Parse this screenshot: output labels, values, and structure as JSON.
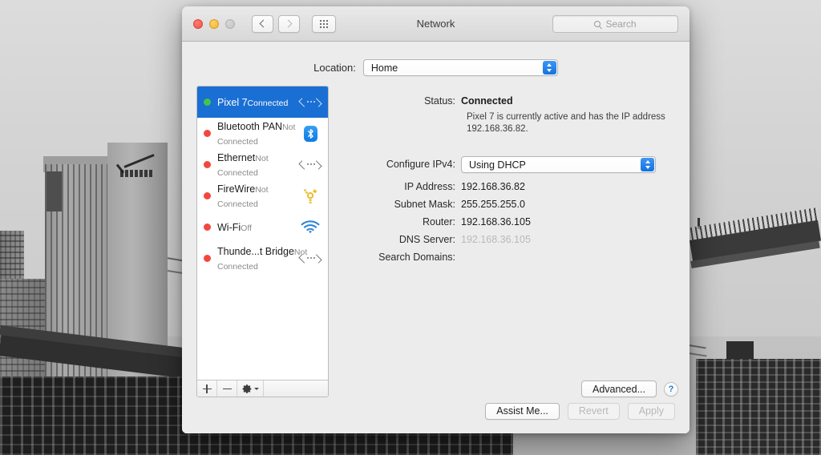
{
  "window": {
    "title": "Network",
    "traffic_lights": [
      "close",
      "minimize",
      "zoom-disabled"
    ],
    "search_placeholder": "Search",
    "back_icon": "chevron-left-icon",
    "forward_icon": "chevron-right-icon",
    "grid_icon": "show-all-grid-icon",
    "search_icon": "search-icon"
  },
  "location": {
    "label": "Location:",
    "value": "Home"
  },
  "services": [
    {
      "name": "Pixel 7",
      "status": "Connected",
      "dot": "green",
      "icon": "ethernet-chevron-icon",
      "selected": true
    },
    {
      "name": "Bluetooth PAN",
      "status": "Not Connected",
      "dot": "red",
      "icon": "bluetooth-icon",
      "selected": false
    },
    {
      "name": "Ethernet",
      "status": "Not Connected",
      "dot": "red",
      "icon": "ethernet-chevron-icon",
      "selected": false
    },
    {
      "name": "FireWire",
      "status": "Not Connected",
      "dot": "red",
      "icon": "firewire-icon",
      "selected": false
    },
    {
      "name": "Wi-Fi",
      "status": "Off",
      "dot": "red",
      "icon": "wifi-icon",
      "selected": false
    },
    {
      "name": "Thunde...t Bridge",
      "status": "Not Connected",
      "dot": "red",
      "icon": "ethernet-chevron-icon",
      "selected": false
    }
  ],
  "list_toolbar": {
    "add_label": "+",
    "remove_label": "−",
    "add_icon": "plus-icon",
    "remove_icon": "minus-icon",
    "gear_icon": "gear-icon",
    "gear_chevron_icon": "chevron-down-icon"
  },
  "detail": {
    "status_label": "Status:",
    "status_value": "Connected",
    "status_description": "Pixel 7 is currently active and has the IP address 192.168.36.82.",
    "configure_label": "Configure IPv4:",
    "configure_value": "Using DHCP",
    "rows": [
      {
        "label": "IP Address:",
        "value": "192.168.36.82",
        "dim": false
      },
      {
        "label": "Subnet Mask:",
        "value": "255.255.255.0",
        "dim": false
      },
      {
        "label": "Router:",
        "value": "192.168.36.105",
        "dim": false
      },
      {
        "label": "DNS Server:",
        "value": "192.168.36.105",
        "dim": true
      },
      {
        "label": "Search Domains:",
        "value": "",
        "dim": false
      }
    ]
  },
  "buttons": {
    "advanced": "Advanced...",
    "help": "?",
    "assist_me": "Assist Me...",
    "revert": "Revert",
    "apply": "Apply",
    "revert_disabled": true,
    "apply_disabled": true
  },
  "colors": {
    "selection_blue": "#1a6fd4",
    "popup_arrow_blue": "#1272e0",
    "status_connected_green": "#41c647",
    "status_disconnected_red": "#f2473f",
    "bluetooth_blue": "#0b7ae4",
    "firewire_gold": "#e8c23a",
    "wifi_blue": "#2f86d8",
    "help_blue": "#1a7fd4",
    "window_chrome": "#ececec",
    "disabled_text": "#b8b8b8"
  }
}
